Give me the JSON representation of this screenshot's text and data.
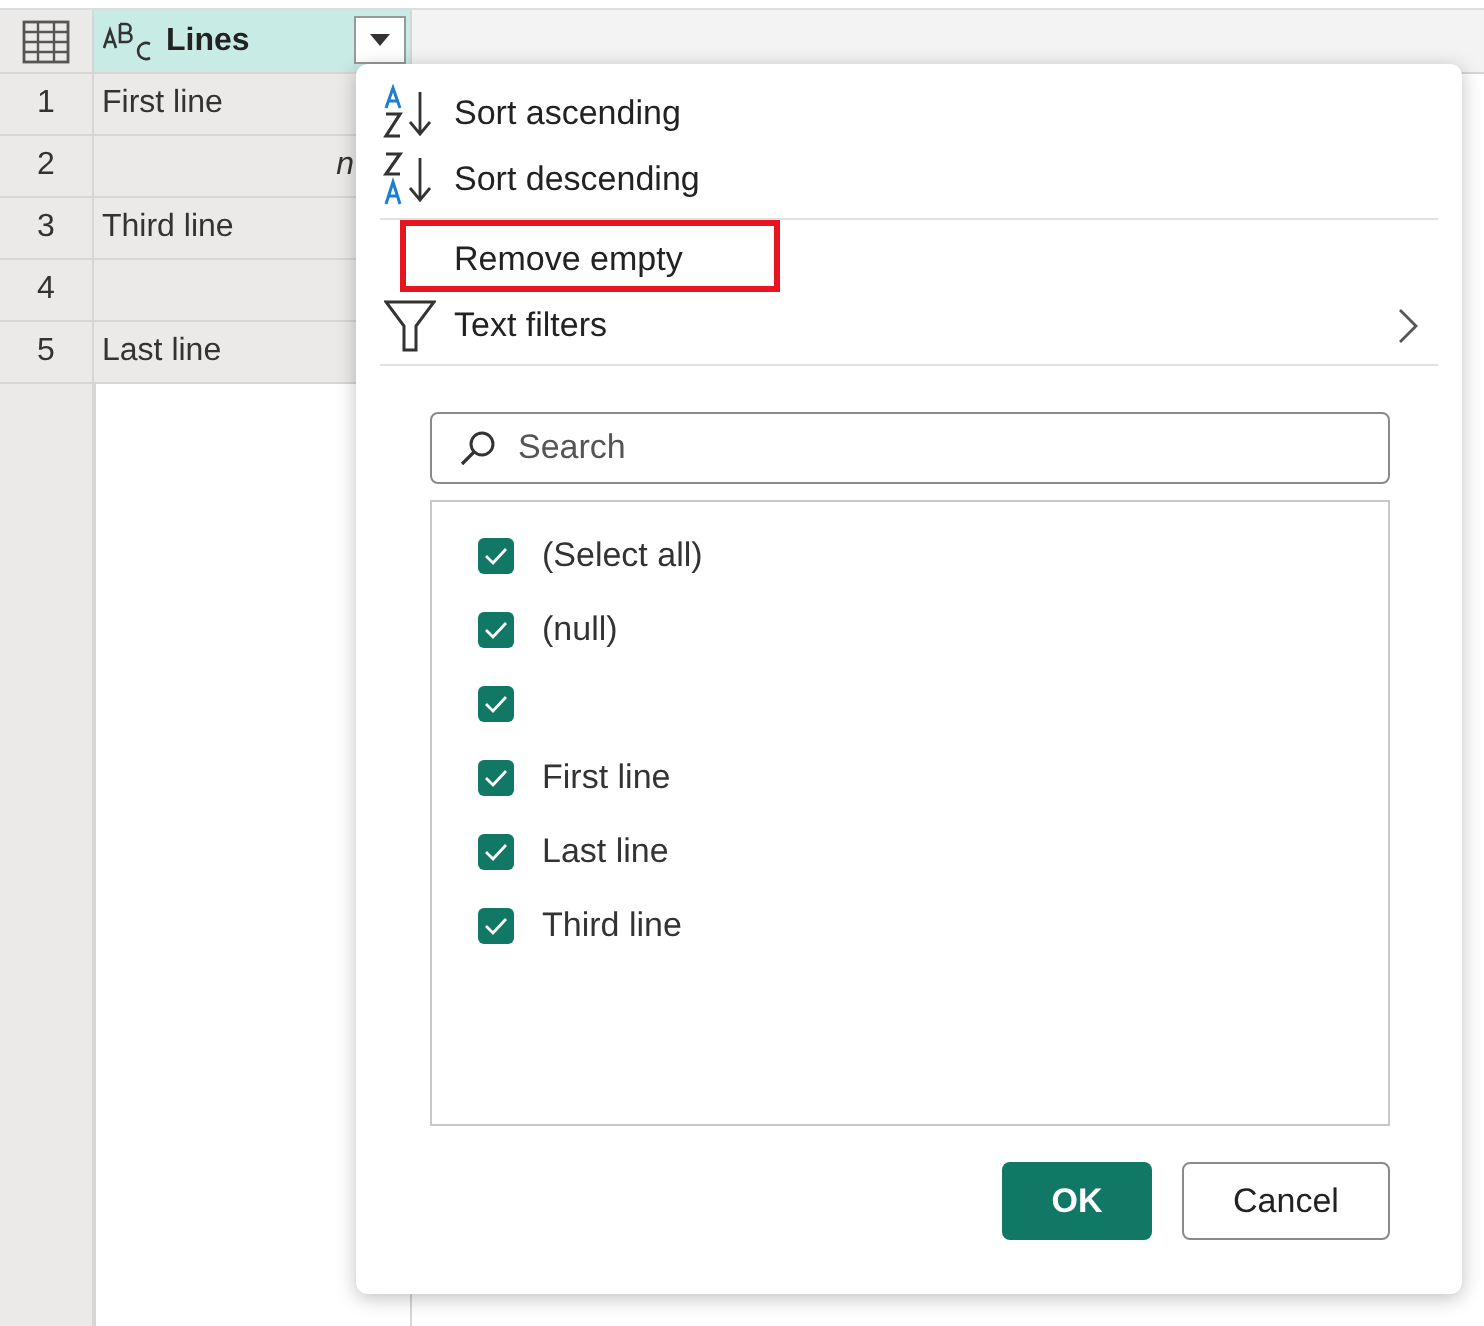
{
  "table": {
    "column": {
      "name": "Lines",
      "selected": true
    },
    "rows": [
      {
        "number": "1",
        "value": "First line",
        "kind": "text"
      },
      {
        "number": "2",
        "value": "n",
        "kind": "null"
      },
      {
        "number": "3",
        "value": "Third line",
        "kind": "text"
      },
      {
        "number": "4",
        "kind": "text"
      },
      {
        "number": "5",
        "value": "Last line",
        "kind": "text"
      }
    ]
  },
  "menu": {
    "items": [
      {
        "label": "Sort ascending",
        "kind": "sort-asc",
        "highlighted": false
      },
      {
        "label": "Sort descending",
        "kind": "sort-desc",
        "highlighted": false
      },
      {
        "label": "Remove empty",
        "kind": "plain",
        "highlighted": true
      },
      {
        "label": "Text filters",
        "kind": "submenu",
        "highlighted": false
      }
    ],
    "search": {
      "placeholder": "Search"
    },
    "values": [
      {
        "label": "(Select all)",
        "checked": true
      },
      {
        "label": "(null)",
        "checked": true
      },
      {
        "checked": true
      },
      {
        "label": "First line",
        "checked": true
      },
      {
        "label": "Last line",
        "checked": true
      },
      {
        "label": "Third line",
        "checked": true
      }
    ],
    "buttons": [
      {
        "label": "OK",
        "kind": "primary"
      },
      {
        "label": "Cancel",
        "kind": "secondary"
      }
    ]
  }
}
